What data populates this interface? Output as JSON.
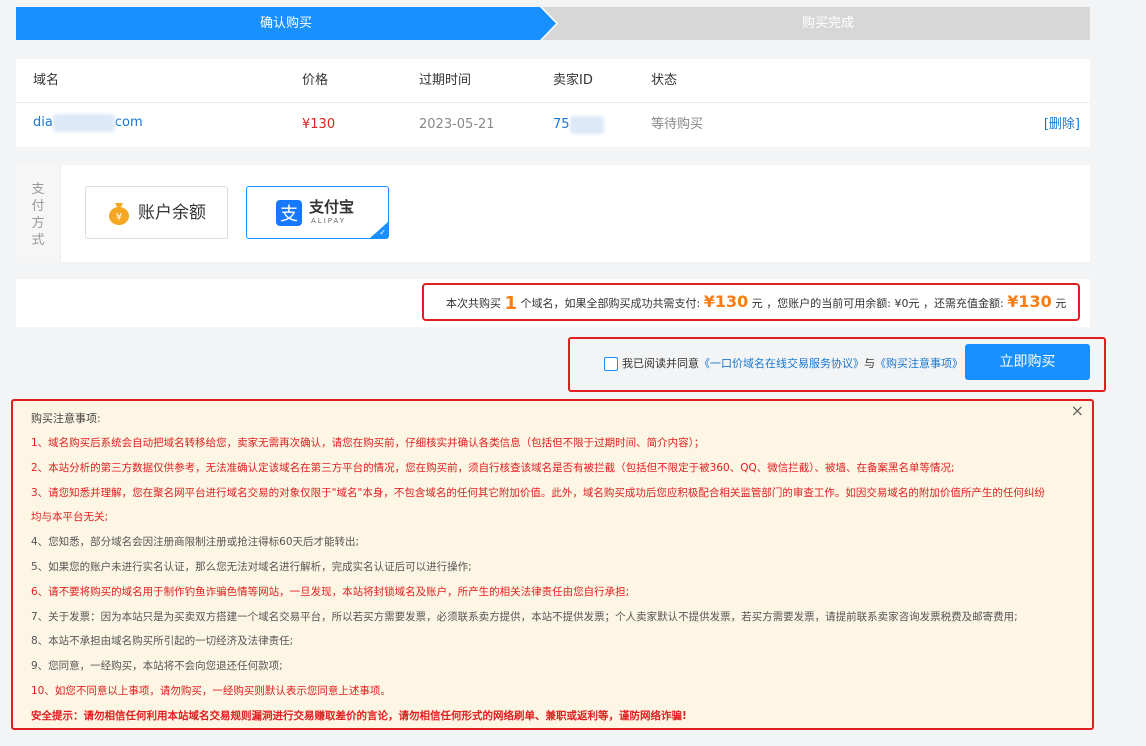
{
  "steps": {
    "step1": "确认购买",
    "step2": "购买完成"
  },
  "table": {
    "headers": {
      "domain": "域名",
      "price": "价格",
      "expire": "过期时间",
      "seller": "卖家ID",
      "status": "状态"
    },
    "row": {
      "domain_prefix": "dia",
      "domain_suffix": "com",
      "price": "¥130",
      "expire": "2023-05-21",
      "seller_prefix": "75",
      "status": "等待购买",
      "delete": "[删除]"
    }
  },
  "payment": {
    "label_chars": [
      "支",
      "付",
      "方",
      "式"
    ],
    "balance_label": "账户余额",
    "alipay_label": "支付宝",
    "alipay_sub": "ALIPAY",
    "selected": "alipay"
  },
  "summary": {
    "p1": "本次共购买",
    "count": "1",
    "p2": "个域名，如果全部购买成功共需支付:",
    "total": "¥130",
    "p3": "元 ，您账户的当前可用余额: ¥0元 ，还需充值金额:",
    "need": "¥130",
    "p4": "元"
  },
  "agree": {
    "text": "我已阅读并同意",
    "link1": "《一口价域名在线交易服务协议》",
    "and": "与",
    "link2": "《购买注意事项》",
    "buy_button": "立即购买"
  },
  "notice": {
    "title": "购买注意事项:",
    "close": "×",
    "items": [
      "1、域名购买后系统会自动把域名转移给您，卖家无需再次确认，请您在购买前，仔细核实并确认各类信息（包括但不限于过期时间、简介内容）；",
      "2、本站分析的第三方数据仅供参考，无法准确认定该域名在第三方平台的情况，您在购买前，须自行核查该域名是否有被拦截（包括但不限定于被360、QQ、微信拦截）、被墙、在备案黑名单等情况;",
      "3、请您知悉并理解，您在聚名网平台进行域名交易的对象仅限于\"域名\"本身，不包含域名的任何其它附加价值。此外，域名购买成功后您应积极配合相关监管部门的审查工作。如因交易域名的附加价值所产生的任何纠纷",
      "均与本平台无关;",
      "4、您知悉，部分域名会因注册商限制注册或抢注得标60天后才能转出;",
      "5、如果您的账户未进行实名认证，那么您无法对域名进行解析，完成实名认证后可以进行操作;",
      "6、请不要将购买的域名用于制作钓鱼诈骗色情等网站，一旦发现，本站将封锁域名及账户，所产生的相关法律责任由您自行承担;",
      "7、关于发票：因为本站只是为买卖双方搭建一个域名交易平台，所以若买方需要发票，必须联系卖方提供，本站不提供发票；个人卖家默认不提供发票，若买方需要发票，请提前联系卖家咨询发票税费及邮寄费用;",
      "8、本站不承担由域名购买所引起的一切经济及法律责任;",
      "9、您同意，一经购买，本站将不会向您退还任何款项;",
      "10、如您不同意以上事项，请勿购买，一经购买则默认表示您同意上述事项。",
      "安全提示：请勿相信任何利用本站域名交易规则漏洞进行交易赚取差价的言论，请勿相信任何形式的网络刷单、兼职或返利等，谨防网络诈骗!"
    ]
  },
  "colors": {
    "primary": "#1890ff",
    "red": "#e02020",
    "orange": "#f97c14",
    "notice_bg": "#fdf6e4"
  }
}
